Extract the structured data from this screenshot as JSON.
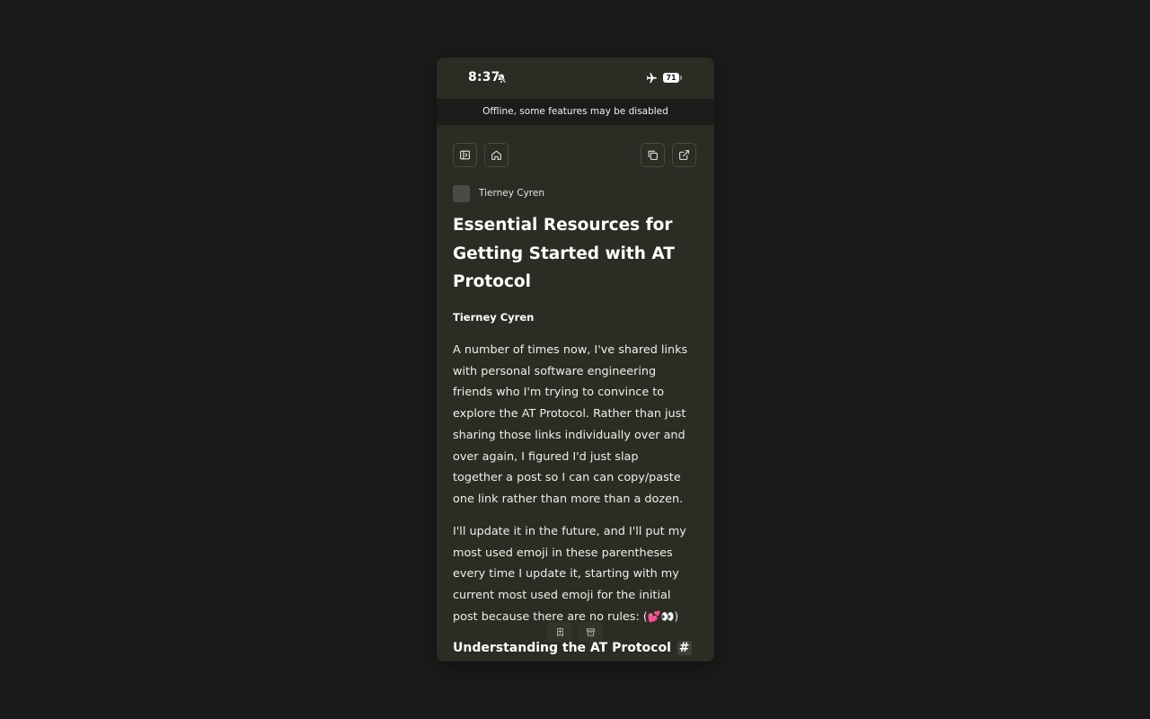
{
  "status_bar": {
    "time": "8:37",
    "battery": "71"
  },
  "offline_banner": "Offline, some features may be disabled",
  "toolbar": {
    "icons": [
      "sidebar-toggle-icon",
      "home-icon",
      "copy-icon",
      "external-link-icon"
    ]
  },
  "author": {
    "name": "Tierney Cyren"
  },
  "article": {
    "title": "Essential Resources for Getting Started with AT Protocol",
    "byline": "Tierney Cyren",
    "paragraph1": "A number of times now, I've shared links with personal software engineering friends who I'm trying to convince to explore the AT Protocol. Rather than just sharing those links individually over and over again, I figured I'd just slap together a post so I can can copy/paste one link rather than more than a dozen.",
    "paragraph2": "I'll update it in the future, and I'll put my most used emoji in these parentheses every time I update it, starting with my current most used emoji for the initial post because there are no rules: ",
    "emoji": "(💕👀)",
    "heading2": "Understanding the AT Protocol",
    "heading2_anchor": "#"
  },
  "floating_actions": {
    "icons": [
      "bookmark-icon",
      "archive-icon"
    ]
  },
  "colors": {
    "background": "#1a1a1a",
    "surface": "#2c2b24",
    "banner": "#1c1c1a",
    "text": "#ffffff"
  }
}
